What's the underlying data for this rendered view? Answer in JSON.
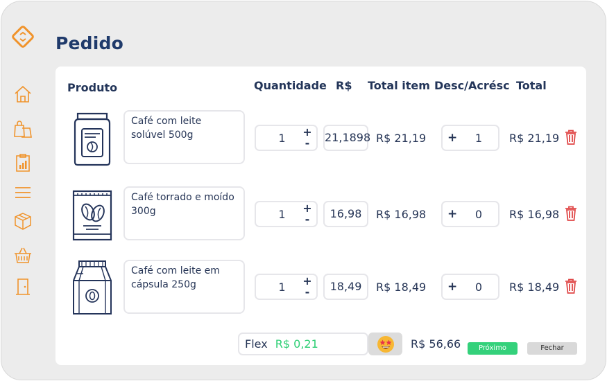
{
  "page": {
    "title": "Pedido"
  },
  "sidebar": {
    "items": [
      {
        "icon": "home-icon"
      },
      {
        "icon": "shopping-bags-icon"
      },
      {
        "icon": "report-chart-icon"
      },
      {
        "icon": "menu-icon"
      },
      {
        "icon": "box-icon"
      },
      {
        "icon": "basket-icon"
      },
      {
        "icon": "exit-door-icon"
      }
    ]
  },
  "table": {
    "headers": {
      "product": "Produto",
      "quantity": "Quantidade",
      "price": "R$",
      "total_item": "Total item",
      "desc": "Desc/Acrésc",
      "total": "Total"
    },
    "rows": [
      {
        "name": "Café com leite solúvel 500g",
        "qty": "1",
        "price": "21,1898",
        "total_item": "R$ 21,19",
        "desc_sign": "+",
        "desc": "1",
        "total": "R$ 21,19",
        "image": "coffee-jar-icon"
      },
      {
        "name": "Café torrado e moído 300g",
        "qty": "1",
        "price": "16,98",
        "total_item": "R$ 16,98",
        "desc_sign": "+",
        "desc": "0",
        "total": "R$ 16,98",
        "image": "coffee-pack-icon"
      },
      {
        "name": "Café com leite em cápsula 250g",
        "qty": "1",
        "price": "18,49",
        "total_item": "R$ 18,49",
        "desc_sign": "+",
        "desc": "0",
        "total": "R$ 18,49",
        "image": "coffee-bag-icon"
      }
    ],
    "plus": "+",
    "minus": "-"
  },
  "footer": {
    "flex_label": "Flex",
    "flex_value": "R$ 0,21",
    "emoji": "star-eyes-emoji",
    "grand_total": "R$ 56,66",
    "next_label": "Próximo",
    "close_label": "Fechar"
  },
  "colors": {
    "accent": "#f0932b",
    "title": "#1f3a6b",
    "success": "#34d17b",
    "flex_value": "#2ecf75",
    "danger": "#e04848"
  }
}
